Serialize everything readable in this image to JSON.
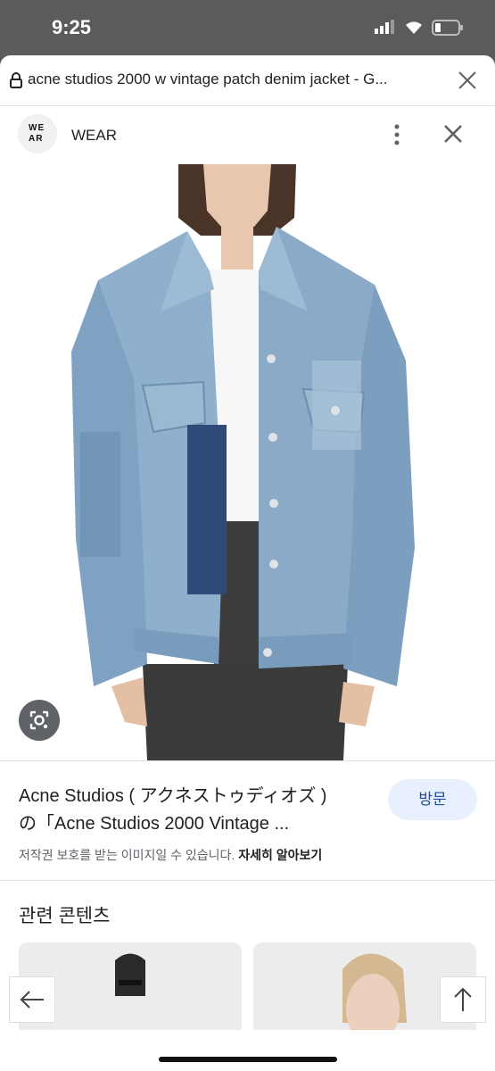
{
  "status_bar": {
    "time": "9:25",
    "signal_icon": "cellular-signal-icon",
    "wifi_icon": "wifi-icon",
    "battery_icon": "battery-low-icon"
  },
  "url_bar": {
    "url_text": "acne studios 2000 w vintage patch denim jacket - G...",
    "lock_icon": "lock-icon",
    "close_icon": "close-icon"
  },
  "site_header": {
    "logo_lines": [
      "WE",
      "AR"
    ],
    "site_name": "WEAR"
  },
  "result": {
    "title_line1": "Acne Studios ( アクネストゥディオズ )",
    "title_line2": "の「Acne Studios 2000 Vintage ...",
    "visit_label": "방문",
    "copyright_text": "저작권 보호를 받는 이미지일 수 있습니다.",
    "learn_more": "자세히 알아보기"
  },
  "related": {
    "heading": "관련 콘텐츠"
  },
  "colors": {
    "accent": "#1a4fa0",
    "visit_bg": "#e8f0fe",
    "denim": "#8aaac8",
    "patch": "#2f4a78"
  }
}
